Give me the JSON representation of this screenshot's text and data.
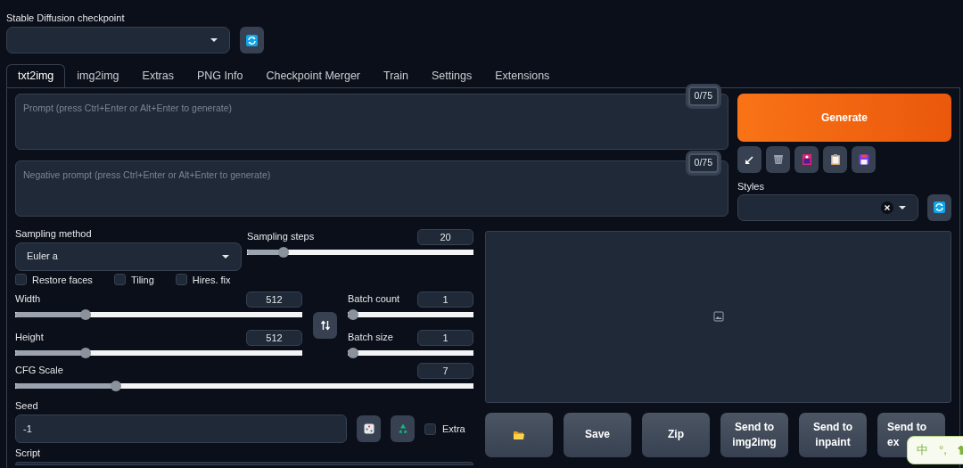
{
  "checkpoint": {
    "label": "Stable Diffusion checkpoint"
  },
  "tabs": [
    {
      "label": "txt2img",
      "selected": true
    },
    {
      "label": "img2img",
      "selected": false
    },
    {
      "label": "Extras",
      "selected": false
    },
    {
      "label": "PNG Info",
      "selected": false
    },
    {
      "label": "Checkpoint Merger",
      "selected": false
    },
    {
      "label": "Train",
      "selected": false
    },
    {
      "label": "Settings",
      "selected": false
    },
    {
      "label": "Extensions",
      "selected": false
    }
  ],
  "prompt": {
    "placeholder": "Prompt (press Ctrl+Enter or Alt+Enter to generate)",
    "counter": "0/75"
  },
  "negative_prompt": {
    "placeholder": "Negative prompt (press Ctrl+Enter or Alt+Enter to generate)",
    "counter": "0/75"
  },
  "generate_button": "Generate",
  "styles": {
    "label": "Styles"
  },
  "sampling_method": {
    "label": "Sampling method",
    "value": "Euler a"
  },
  "sampling_steps": {
    "label": "Sampling steps",
    "value": "20",
    "level": 0.146
  },
  "checkboxes": [
    {
      "label": "Restore faces",
      "checked": false
    },
    {
      "label": "Tiling",
      "checked": false
    },
    {
      "label": "Hires. fix",
      "checked": false
    }
  ],
  "width": {
    "label": "Width",
    "value": "512",
    "level": 0.236
  },
  "height": {
    "label": "Height",
    "value": "512",
    "level": 0.236
  },
  "batch_count": {
    "label": "Batch count",
    "value": "1",
    "level": 0
  },
  "batch_size": {
    "label": "Batch size",
    "value": "1",
    "level": 0
  },
  "cfg_scale": {
    "label": "CFG Scale",
    "value": "7",
    "level": 0.214
  },
  "seed": {
    "label": "Seed",
    "value": "-1",
    "extra": {
      "label": "Extra",
      "checked": false
    }
  },
  "script": {
    "label": "Script"
  },
  "output_buttons": [
    {
      "kind": "icon"
    },
    {
      "kind": "text",
      "label": "Save"
    },
    {
      "kind": "text",
      "label": "Zip"
    },
    {
      "kind": "text",
      "label": "Send to img2img"
    },
    {
      "kind": "text",
      "label": "Send to inpaint"
    },
    {
      "kind": "text",
      "label": "Send to ex"
    }
  ],
  "ime_toolbar": {
    "items": [
      "中",
      "°,"
    ]
  }
}
